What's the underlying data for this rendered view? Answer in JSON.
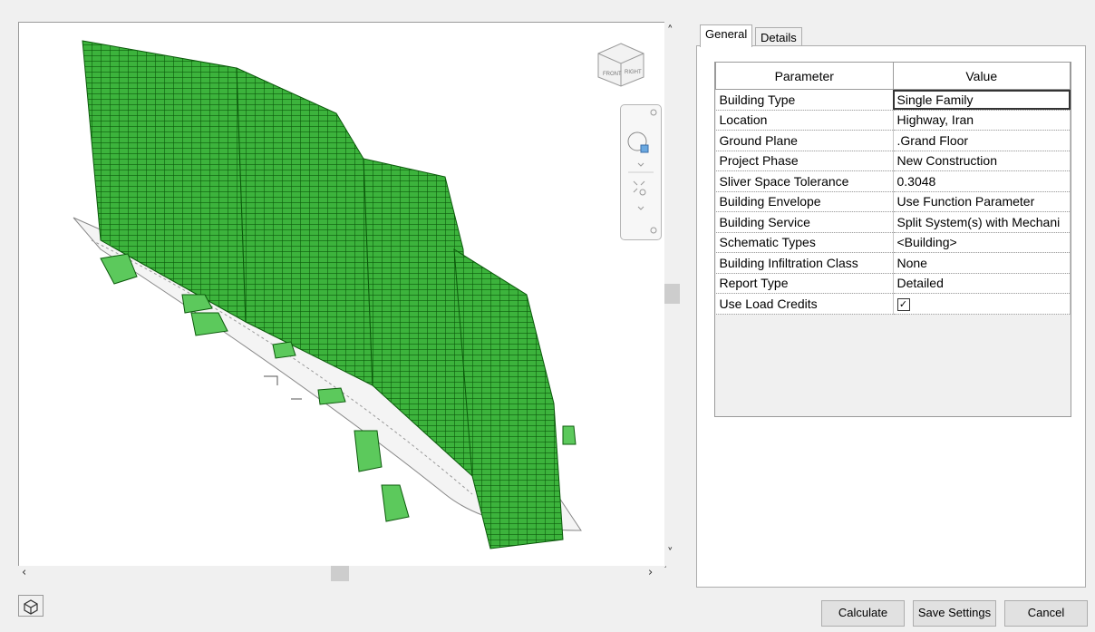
{
  "tabs": [
    {
      "label": "General",
      "active": true
    },
    {
      "label": "Details",
      "active": false
    }
  ],
  "grid": {
    "headers": {
      "parameter": "Parameter",
      "value": "Value"
    },
    "rows": [
      {
        "parameter": "Building Type",
        "value": "Single Family"
      },
      {
        "parameter": "Location",
        "value": "Highway, Iran"
      },
      {
        "parameter": "Ground Plane",
        "value": ".Grand Floor"
      },
      {
        "parameter": "Project Phase",
        "value": "New Construction"
      },
      {
        "parameter": "Sliver Space Tolerance",
        "value": "0.3048"
      },
      {
        "parameter": "Building Envelope",
        "value": "Use Function Parameter"
      },
      {
        "parameter": "Building Service",
        "value": "Split System(s) with Mechani"
      },
      {
        "parameter": "Schematic Types",
        "value": "<Building>"
      },
      {
        "parameter": "Building Infiltration Class",
        "value": "None"
      },
      {
        "parameter": "Report Type",
        "value": "Detailed"
      },
      {
        "parameter": "Use Load Credits",
        "value": "☑"
      }
    ]
  },
  "buttons": {
    "calculate": "Calculate",
    "save_settings": "Save Settings",
    "cancel": "Cancel"
  },
  "viewcube": {
    "front": "FRONT",
    "right": "RIGHT"
  },
  "icons": {
    "scroll_up": "▲",
    "scroll_down": "▼",
    "scroll_left": "◀",
    "scroll_right": "▶",
    "view_3d": "3d-view-icon"
  },
  "colors": {
    "model_green": "#1f9e1f",
    "model_edge": "#0b5a0b"
  }
}
